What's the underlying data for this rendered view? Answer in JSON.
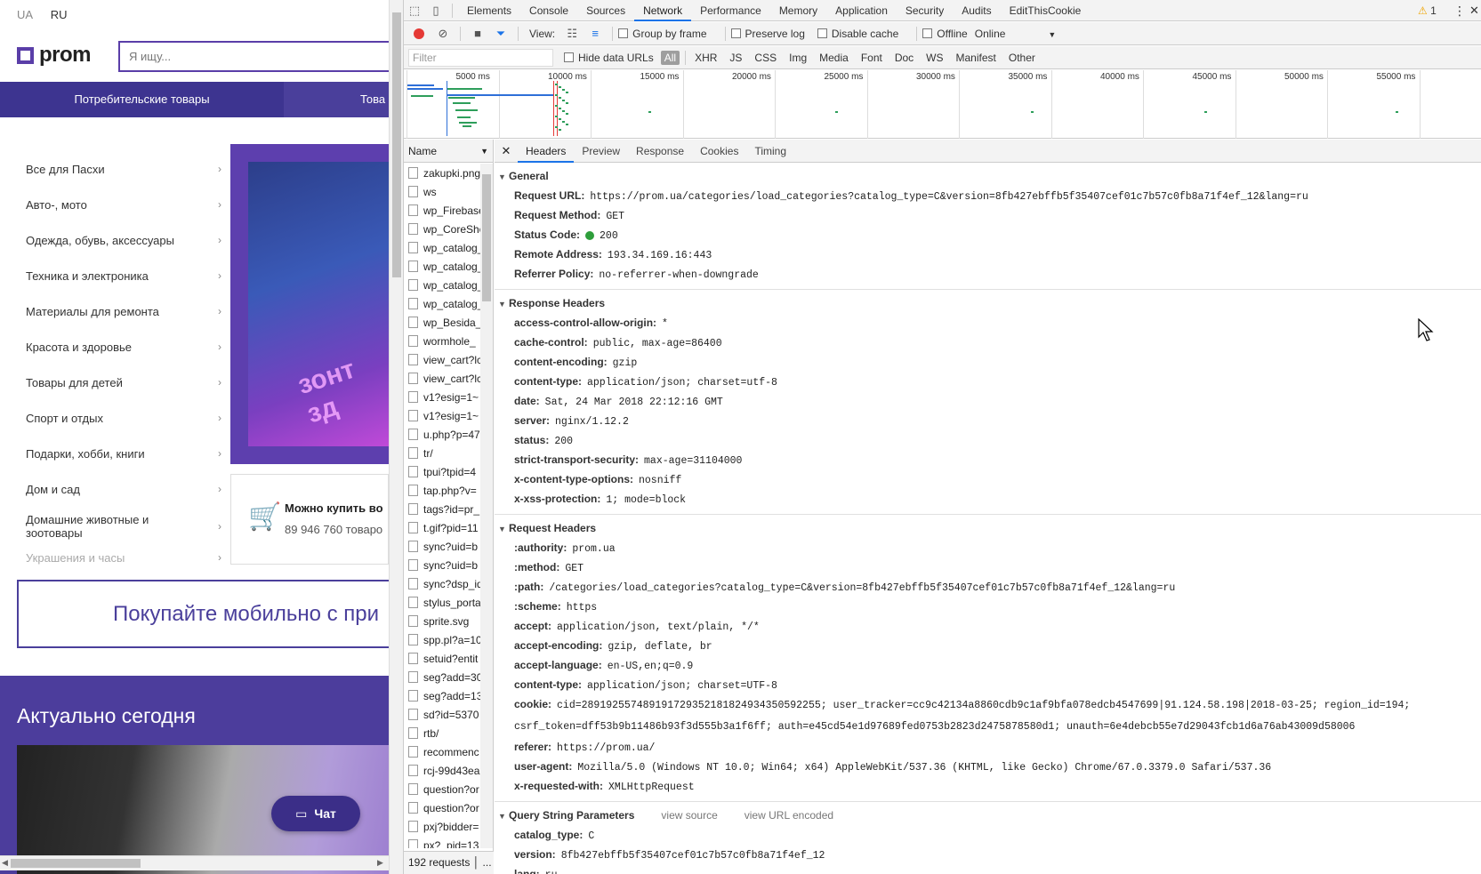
{
  "site": {
    "lang": [
      "UA",
      "RU"
    ],
    "logo": "prom",
    "search_placeholder": "Я ищу...",
    "catbar": [
      "Потребительские товары",
      "Това"
    ],
    "categories": [
      "Все для Пасхи",
      "Авто-, мото",
      "Одежда, обувь, аксессуары",
      "Техника и электроника",
      "Материалы для ремонта",
      "Красота и здоровье",
      "Товары для детей",
      "Спорт и отдых",
      "Подарки, хобби, книги",
      "Дом и сад",
      "Домашние животные и зоотовары",
      "Украшения и часы"
    ],
    "banner_text": "зонт зд",
    "cart_title": "Можно купить во",
    "cart_count": "89 946 760 товаро",
    "mobile_promo": "Покупайте мобильно с при",
    "today_title": "Актуально сегодня",
    "chat": "Чат"
  },
  "devtools": {
    "tabs": [
      "Elements",
      "Console",
      "Sources",
      "Network",
      "Performance",
      "Memory",
      "Application",
      "Security",
      "Audits",
      "EditThisCookie"
    ],
    "active_tab": "Network",
    "warning_count": "1",
    "netbar": {
      "view": "View:",
      "group_by_frame": "Group by frame",
      "preserve_log": "Preserve log",
      "disable_cache": "Disable cache",
      "offline": "Offline",
      "online": "Online"
    },
    "filter": {
      "placeholder": "Filter",
      "hide_data_urls": "Hide data URLs",
      "types": [
        "All",
        "XHR",
        "JS",
        "CSS",
        "Img",
        "Media",
        "Font",
        "Doc",
        "WS",
        "Manifest",
        "Other"
      ]
    },
    "timeline_ticks": [
      "5000 ms",
      "10000 ms",
      "15000 ms",
      "20000 ms",
      "25000 ms",
      "30000 ms",
      "35000 ms",
      "40000 ms",
      "45000 ms",
      "50000 ms",
      "55000 ms"
    ],
    "name_header": "Name",
    "requests": [
      "zakupki.png",
      "ws",
      "wp_Firebase",
      "wp_CoreSho",
      "wp_catalog_",
      "wp_catalog_",
      "wp_catalog_",
      "wp_catalog_",
      "wp_Besida_",
      "wormhole_",
      "view_cart?lc",
      "view_cart?lc",
      "v1?esig=1~",
      "v1?esig=1~",
      "u.php?p=47",
      "tr/",
      "tpui?tpid=4",
      "tap.php?v=",
      "tags?id=pr_",
      "t.gif?pid=11",
      "sync?uid=b",
      "sync?uid=b",
      "sync?dsp_id",
      "stylus_porta",
      "sprite.svg",
      "spp.pl?a=10",
      "setuid?entit",
      "seg?add=30",
      "seg?add=13",
      "sd?id=5370",
      "rtb/",
      "recommenc",
      "rcj-99d43ea",
      "question?or",
      "question?or",
      "pxj?bidder=",
      "px?_pid=13"
    ],
    "footer": "192 requests",
    "detail_tabs": [
      "Headers",
      "Preview",
      "Response",
      "Cookies",
      "Timing"
    ],
    "general": {
      "title": "General",
      "items": [
        {
          "k": "Request URL:",
          "v": "https://prom.ua/categories/load_categories?catalog_type=C&version=8fb427ebffb5f35407cef01c7b57c0fb8a71f4ef_12&lang=ru"
        },
        {
          "k": "Request Method:",
          "v": "GET"
        },
        {
          "k": "Status Code:",
          "v": "200"
        },
        {
          "k": "Remote Address:",
          "v": "193.34.169.16:443"
        },
        {
          "k": "Referrer Policy:",
          "v": "no-referrer-when-downgrade"
        }
      ]
    },
    "response_headers": {
      "title": "Response Headers",
      "items": [
        {
          "k": "access-control-allow-origin:",
          "v": "*"
        },
        {
          "k": "cache-control:",
          "v": "public, max-age=86400"
        },
        {
          "k": "content-encoding:",
          "v": "gzip"
        },
        {
          "k": "content-type:",
          "v": "application/json; charset=utf-8"
        },
        {
          "k": "date:",
          "v": "Sat, 24 Mar 2018 22:12:16 GMT"
        },
        {
          "k": "server:",
          "v": "nginx/1.12.2"
        },
        {
          "k": "status:",
          "v": "200"
        },
        {
          "k": "strict-transport-security:",
          "v": "max-age=31104000"
        },
        {
          "k": "x-content-type-options:",
          "v": "nosniff"
        },
        {
          "k": "x-xss-protection:",
          "v": "1; mode=block"
        }
      ]
    },
    "request_headers": {
      "title": "Request Headers",
      "items": [
        {
          "k": ":authority:",
          "v": "prom.ua"
        },
        {
          "k": ":method:",
          "v": "GET"
        },
        {
          "k": ":path:",
          "v": "/categories/load_categories?catalog_type=C&version=8fb427ebffb5f35407cef01c7b57c0fb8a71f4ef_12&lang=ru"
        },
        {
          "k": ":scheme:",
          "v": "https"
        },
        {
          "k": "accept:",
          "v": "application/json, text/plain, */*"
        },
        {
          "k": "accept-encoding:",
          "v": "gzip, deflate, br"
        },
        {
          "k": "accept-language:",
          "v": "en-US,en;q=0.9"
        },
        {
          "k": "content-type:",
          "v": "application/json; charset=UTF-8"
        },
        {
          "k": "cookie:",
          "v": "cid=289192557489191729352181824934350592255; user_tracker=cc9c42134a8860cdb9c1af9bfa078edcb4547699|91.124.58.198|2018-03-25; region_id=194; csrf_token=dff53b9b11486b93f3d555b3a1f6ff; auth=e45cd54e1d97689fed0753b2823d2475878580d1; unauth=6e4debcb55e7d29043fcb1d6a76ab43009d58006"
        },
        {
          "k": "referer:",
          "v": "https://prom.ua/"
        },
        {
          "k": "user-agent:",
          "v": "Mozilla/5.0 (Windows NT 10.0; Win64; x64) AppleWebKit/537.36 (KHTML, like Gecko) Chrome/67.0.3379.0 Safari/537.36"
        },
        {
          "k": "x-requested-with:",
          "v": "XMLHttpRequest"
        }
      ]
    },
    "query": {
      "title": "Query String Parameters",
      "view_source": "view source",
      "view_url_encoded": "view URL encoded",
      "items": [
        {
          "k": "catalog_type:",
          "v": "C"
        },
        {
          "k": "version:",
          "v": "8fb427ebffb5f35407cef01c7b57c0fb8a71f4ef_12"
        },
        {
          "k": "lang:",
          "v": "ru"
        }
      ]
    }
  }
}
